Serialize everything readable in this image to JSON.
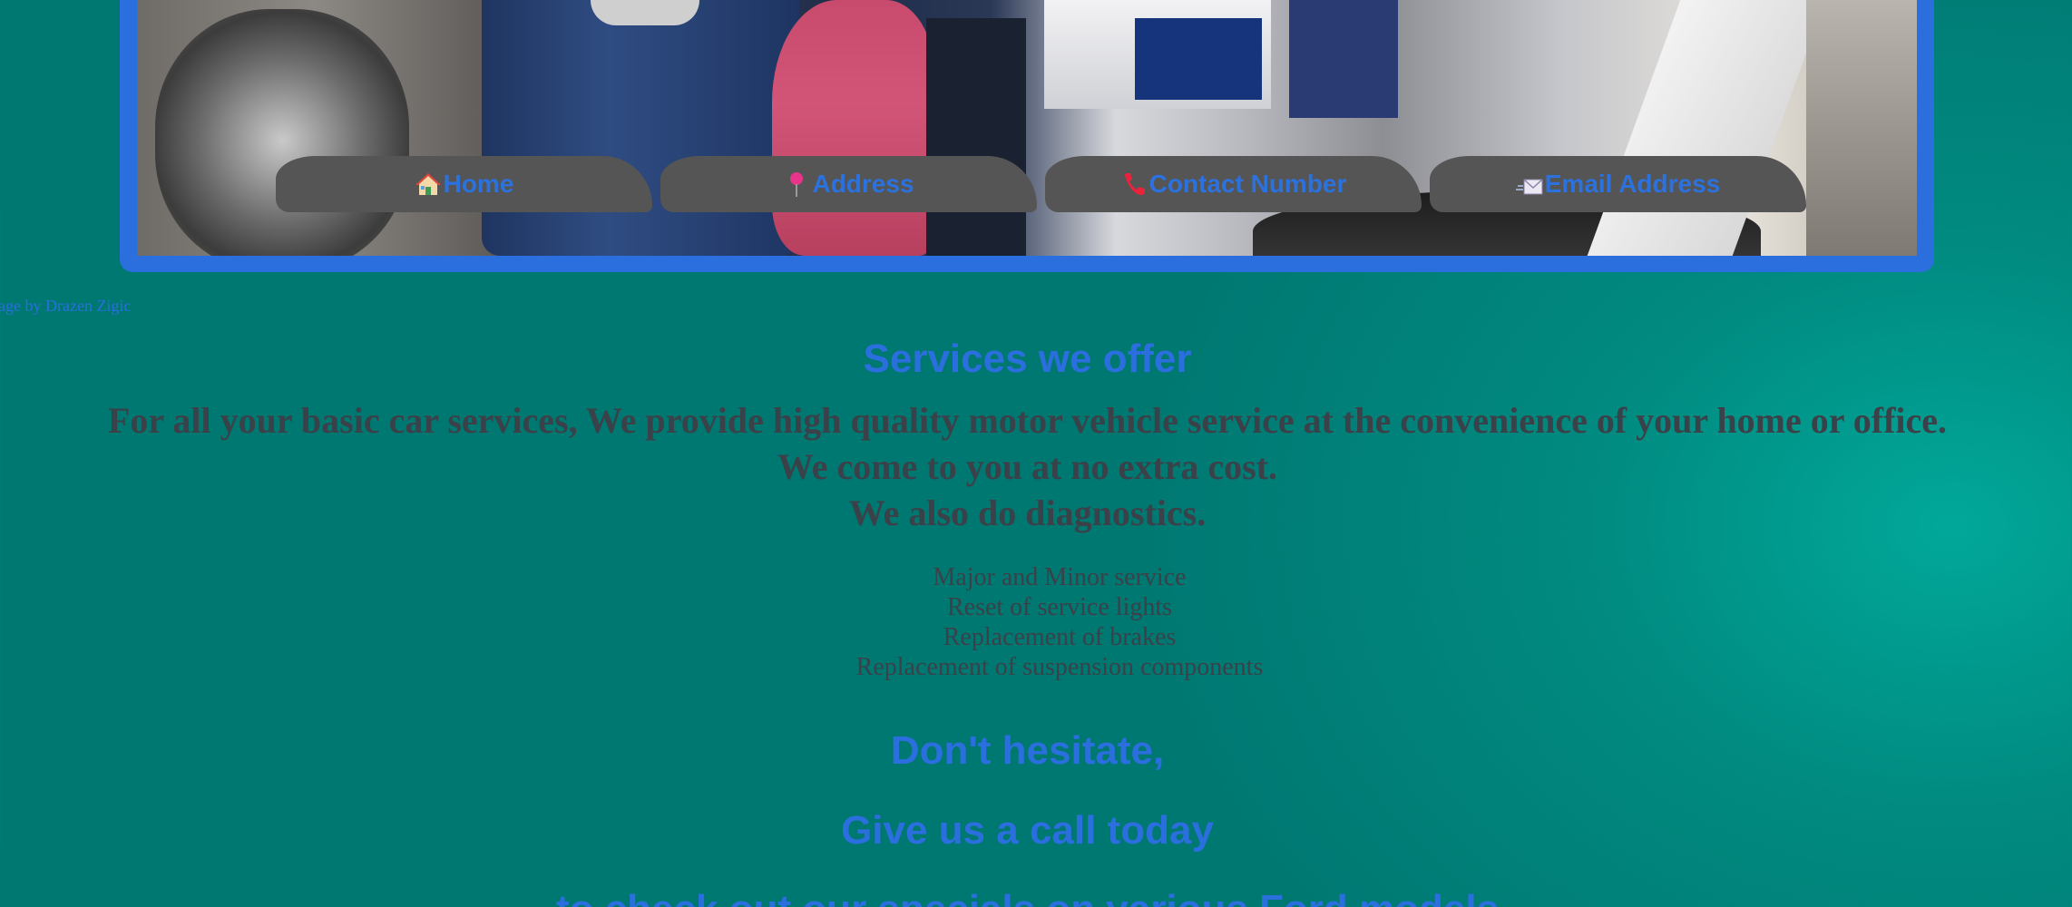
{
  "nav": {
    "items": [
      {
        "label": "Home",
        "icon": "house-icon"
      },
      {
        "label": "Address",
        "icon": "pin-icon"
      },
      {
        "label": "Contact Number",
        "icon": "phone-icon"
      },
      {
        "label": "Email Address",
        "icon": "envelope-icon"
      }
    ]
  },
  "hero": {
    "image_credit": "age by Drazen Zigic"
  },
  "services": {
    "title": "Services we offer",
    "intro": [
      "For all your basic car services, We provide high quality motor vehicle service at the convenience of your home or office.",
      "We come to you at no extra cost.",
      "We also do diagnostics."
    ],
    "list": [
      "Major and Minor service",
      "Reset of service lights",
      "Replacement of brakes",
      "Replacement of suspension components"
    ]
  },
  "cta": {
    "line1": "Don't hesitate,",
    "line2": "Give us a call today",
    "line3": "to check out our specials on various Ford models"
  },
  "colors": {
    "accent": "#2a6fdd",
    "nav_bg": "#565555",
    "body_text": "#3a4148",
    "background": "#008078"
  }
}
